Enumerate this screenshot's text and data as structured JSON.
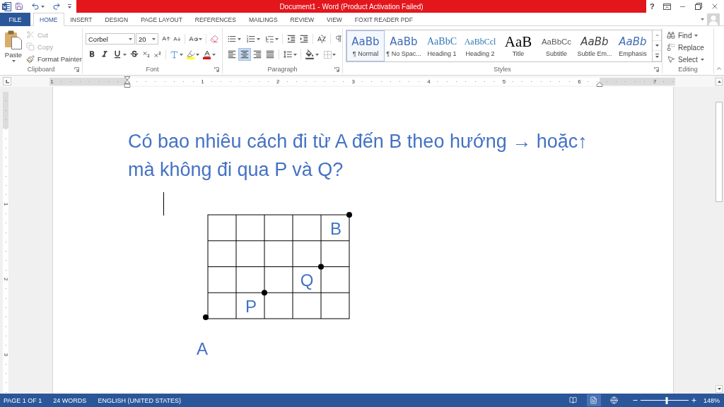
{
  "title_bar": {
    "title": "Document1 - Word (Product Activation Failed)",
    "help": "?"
  },
  "tabs": [
    {
      "label": "FILE",
      "kind": "file",
      "selected": false
    },
    {
      "label": "HOME",
      "kind": "tab",
      "selected": true
    },
    {
      "label": "INSERT",
      "kind": "tab",
      "selected": false
    },
    {
      "label": "DESIGN",
      "kind": "tab",
      "selected": false
    },
    {
      "label": "PAGE LAYOUT",
      "kind": "tab",
      "selected": false
    },
    {
      "label": "REFERENCES",
      "kind": "tab",
      "selected": false
    },
    {
      "label": "MAILINGS",
      "kind": "tab",
      "selected": false
    },
    {
      "label": "REVIEW",
      "kind": "tab",
      "selected": false
    },
    {
      "label": "VIEW",
      "kind": "tab",
      "selected": false
    },
    {
      "label": "FOXIT READER PDF",
      "kind": "tab",
      "selected": false
    }
  ],
  "clipboard": {
    "label": "Clipboard",
    "paste": "Paste",
    "commands": [
      {
        "label": "Cut",
        "kind": "cut",
        "disabled": true
      },
      {
        "label": "Copy",
        "kind": "copy",
        "disabled": true
      },
      {
        "label": "Format Painter",
        "kind": "painter",
        "disabled": false
      }
    ]
  },
  "font": {
    "label": "Font",
    "font_name": "Corbel",
    "font_size": "20"
  },
  "paragraph": {
    "label": "Paragraph",
    "alignment": [
      {
        "kind": "left",
        "selected": false
      },
      {
        "kind": "center",
        "selected": true
      },
      {
        "kind": "right",
        "selected": false
      },
      {
        "kind": "justify",
        "selected": false
      }
    ]
  },
  "styles": {
    "label": "Styles",
    "items": [
      {
        "preview": "AaBb",
        "name": "¶ Normal",
        "kind": "normal",
        "selected": true
      },
      {
        "preview": "AaBb",
        "name": "¶ No Spac...",
        "kind": "no_spacing",
        "selected": false
      },
      {
        "preview": "AaBbC",
        "name": "Heading 1",
        "kind": "heading1",
        "selected": false
      },
      {
        "preview": "AaBbCcl",
        "name": "Heading 2",
        "kind": "heading2",
        "selected": false
      },
      {
        "preview": "AaB",
        "name": "Title",
        "kind": "title",
        "selected": false
      },
      {
        "preview": "AaBbCc",
        "name": "Subtitle",
        "kind": "subtitle",
        "selected": false
      },
      {
        "preview": "AaBb",
        "name": "Subtle Em...",
        "kind": "subtle_emphasis",
        "selected": false
      },
      {
        "preview": "AaBb",
        "name": "Emphasis",
        "kind": "emphasis",
        "selected": false
      }
    ]
  },
  "editing": {
    "label": "Editing",
    "commands": [
      {
        "label": "Find",
        "kind": "find"
      },
      {
        "label": "Replace",
        "kind": "replace"
      },
      {
        "label": "Select",
        "kind": "select"
      }
    ]
  },
  "ruler": {
    "marks": [
      "1",
      "1",
      "2",
      "3",
      "4",
      "5",
      "6",
      "7"
    ]
  },
  "vertical_ruler": {
    "marks": [
      "1",
      "2",
      "3"
    ]
  },
  "document": {
    "question": [
      "Có bao nhiêu cách đi từ A đến B theo hướng → hoặc↑",
      "mà không đi qua P và Q?"
    ],
    "points": [
      {
        "label": "B"
      },
      {
        "label": "Q"
      },
      {
        "label": "P"
      },
      {
        "label": "A"
      }
    ]
  },
  "status_bar": {
    "page": "PAGE 1 OF 1",
    "words": "24 WORDS",
    "language": "ENGLISH (UNITED STATES)",
    "views": [
      {
        "kind": "read",
        "selected": false
      },
      {
        "kind": "print",
        "selected": true
      },
      {
        "kind": "web",
        "selected": false
      }
    ],
    "zoom": {
      "level": 0.55,
      "reading": "148%"
    }
  }
}
